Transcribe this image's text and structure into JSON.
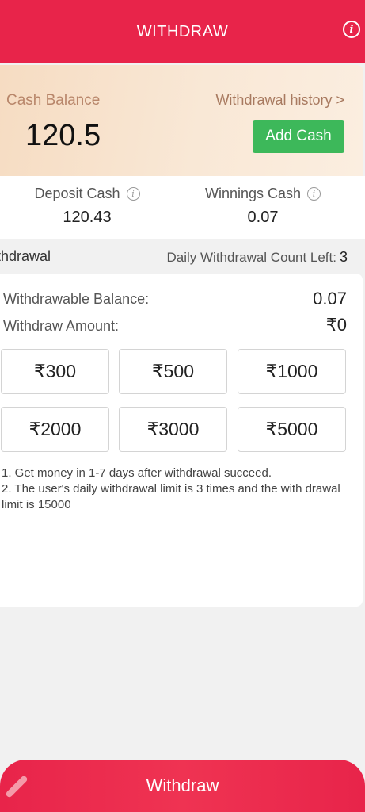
{
  "header": {
    "title": "WITHDRAW",
    "info_glyph": "i"
  },
  "balance": {
    "cash_label": "Cash Balance",
    "cash_value": "120.5",
    "history_link": "Withdrawal history >",
    "add_cash_label": "Add Cash"
  },
  "sub_balances": {
    "deposit": {
      "label": "Deposit Cash",
      "value": "120.43"
    },
    "winnings": {
      "label": "Winnings Cash",
      "value": "0.07"
    },
    "info_glyph": "i"
  },
  "withdrawal": {
    "section_title": "ithdrawal",
    "count_label": "Daily Withdrawal Count Left:",
    "count_value": "3",
    "withdrawable_label": "Withdrawable Balance:",
    "withdrawable_value": "0.07",
    "amount_label": "Withdraw Amount:",
    "amount_value": "₹0",
    "amounts": [
      "₹300",
      "₹500",
      "₹1000",
      "₹2000",
      "₹3000",
      "₹5000"
    ],
    "notes": [
      "1. Get money in 1-7 days after withdrawal succeed.",
      "2. The user's daily withdrawal limit is 3 times and the with drawal limit is 15000"
    ]
  },
  "footer": {
    "withdraw_label": "Withdraw"
  },
  "colors": {
    "accent": "#e8244a",
    "add_cash": "#3db85a",
    "card_gradient_start": "#f6dcc2"
  }
}
